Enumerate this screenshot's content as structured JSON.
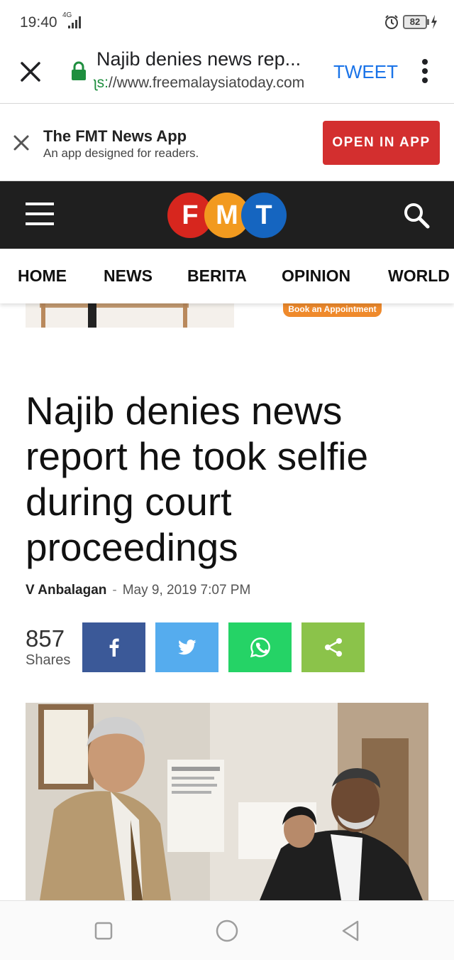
{
  "status_bar": {
    "time": "19:40",
    "network": "4G",
    "battery": "82",
    "icons": [
      "signal-icon",
      "alarm-icon",
      "battery-icon",
      "charging-icon"
    ]
  },
  "browser": {
    "page_title": "Najib denies news rep...",
    "url_scheme": "ʅs:",
    "url_rest": "//www.freemalaysiatoday.com",
    "tweet_label": "TWEET",
    "icons": [
      "close-icon",
      "lock-icon",
      "more-vert-icon"
    ]
  },
  "app_banner": {
    "title": "The FMT News App",
    "subtitle": "An app designed for readers.",
    "open_label": "OPEN IN APP"
  },
  "site_header": {
    "logo_letters": [
      "F",
      "M",
      "T"
    ],
    "logo_colors": [
      "#d7261e",
      "#f29a1f",
      "#1565c0"
    ],
    "header_bg": "#1f1f1f",
    "icons": [
      "menu-icon",
      "search-icon"
    ]
  },
  "nav": {
    "items": [
      "HOME",
      "NEWS",
      "BERITA",
      "OPINION",
      "WORLD"
    ]
  },
  "ad": {
    "button_label": "Book an Appointment"
  },
  "article": {
    "headline": "Najib denies news report he took selfie during court proceedings",
    "author": "V Anbalagan",
    "separator": "-",
    "date": "May 9, 2019 7:07 PM"
  },
  "shares": {
    "count": "857",
    "label": "Shares",
    "buttons": [
      {
        "name": "facebook",
        "color": "#3b5998"
      },
      {
        "name": "twitter",
        "color": "#55acee"
      },
      {
        "name": "whatsapp",
        "color": "#25d366"
      },
      {
        "name": "share",
        "color": "#8bc34a"
      }
    ]
  },
  "system_nav": {
    "icons": [
      "recents-icon",
      "home-icon",
      "back-icon"
    ]
  }
}
